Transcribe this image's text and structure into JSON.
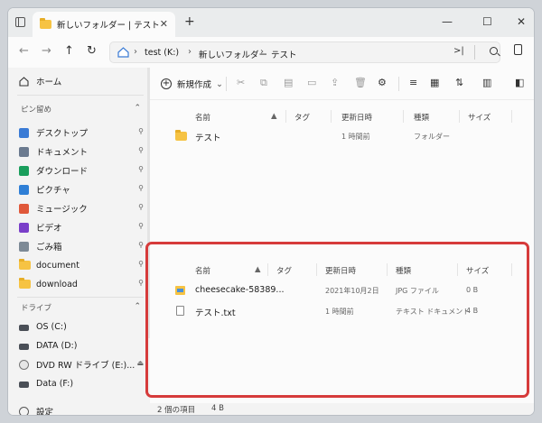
{
  "titlebar": {
    "tab_title": "新しいフォルダー | テスト",
    "tab_close": "✕",
    "new_tab": "+",
    "minimize": "—",
    "maximize": "☐",
    "close": "✕"
  },
  "nav": {
    "back": "←",
    "forward": "→",
    "up": "↑",
    "refresh": "↻",
    "breadcrumbs": [
      "test (K:)",
      "新しいフォルダー",
      "テスト"
    ],
    "separator": "›",
    "address_extra": ">|"
  },
  "sidebar": {
    "home": "ホーム",
    "pinned_header": "ピン留め",
    "drives_header": "ドライブ",
    "pinned_items": [
      {
        "label": "デスクトップ",
        "icon": "desktop-icon",
        "color": "#3a7bd5"
      },
      {
        "label": "ドキュメント",
        "icon": "documents-icon",
        "color": "#6b7a8f"
      },
      {
        "label": "ダウンロード",
        "icon": "download-icon",
        "color": "#1a9e5c"
      },
      {
        "label": "ピクチャ",
        "icon": "pictures-icon",
        "color": "#2f7fd6"
      },
      {
        "label": "ミュージック",
        "icon": "music-icon",
        "color": "#e0583a"
      },
      {
        "label": "ビデオ",
        "icon": "videos-icon",
        "color": "#7a3fc9"
      },
      {
        "label": "ごみ箱",
        "icon": "recycle-bin-icon",
        "color": "#7d8a96"
      },
      {
        "label": "document",
        "icon": "folder-icon",
        "color": "#f6c343"
      },
      {
        "label": "download",
        "icon": "folder-icon",
        "color": "#f6c343"
      }
    ],
    "drives": [
      {
        "label": "OS (C:)",
        "icon": "drive-icon"
      },
      {
        "label": "DATA (D:)",
        "icon": "drive-icon"
      },
      {
        "label": "DVD RW ドライブ (E:)...",
        "icon": "dvd-drive-icon"
      },
      {
        "label": "Data (F:)",
        "icon": "drive-icon"
      }
    ],
    "settings": "設定"
  },
  "toolbar": {
    "new_label": "新規作成",
    "new_chevron": "⌄"
  },
  "columns": {
    "name": "名前",
    "tags": "タグ",
    "modified": "更新日時",
    "type": "種類",
    "size": "サイズ"
  },
  "upper_pane": {
    "rows": [
      {
        "name": "テスト",
        "modified": "1 時間前",
        "type": "フォルダー",
        "size": ""
      }
    ]
  },
  "lower_pane": {
    "rows": [
      {
        "name": "cheesecake-58389...",
        "modified": "2021年10月2日",
        "type": "JPG ファイル",
        "size": "0 B"
      },
      {
        "name": "テスト.txt",
        "modified": "1 時間前",
        "type": "テキスト ドキュメント",
        "size": "4 B"
      }
    ]
  },
  "status": {
    "items": "2 個の項目",
    "size": "4 B"
  },
  "colors": {
    "highlight": "#d63b3b",
    "folder": "#f6c343"
  }
}
